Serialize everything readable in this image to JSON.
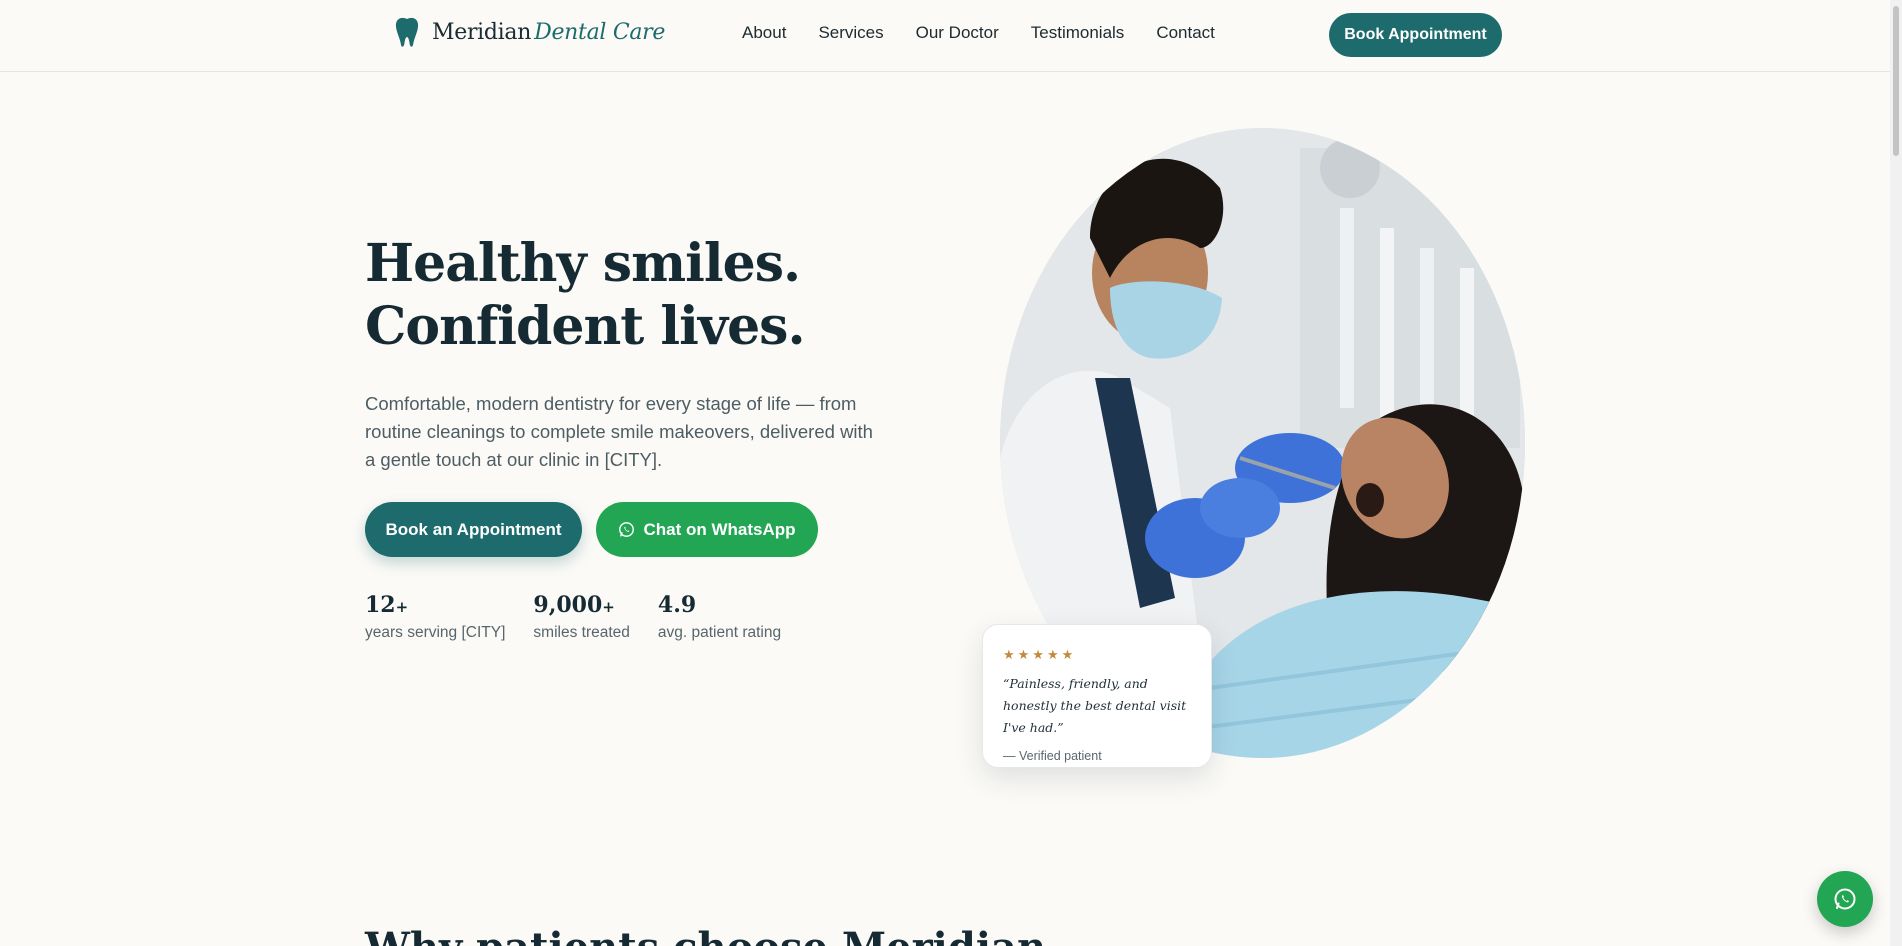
{
  "brand": {
    "name": "Meridian",
    "accent": "Dental Care",
    "icon": "tooth-icon",
    "color": "#1d6b6c"
  },
  "nav": {
    "items": [
      "About",
      "Services",
      "Our Doctor",
      "Testimonials",
      "Contact"
    ],
    "cta": "Book Appointment"
  },
  "hero": {
    "title_line1": "Healthy smiles.",
    "title_line2": "Confident lives.",
    "subtitle": "Comfortable, modern dentistry for every stage of life — from routine cleanings to complete smile makeovers, delivered with a gentle touch at our clinic in [CITY].",
    "primary_cta": "Book an Appointment",
    "whatsapp_cta": "Chat on WhatsApp",
    "whatsapp_color": "#22a654",
    "stats": [
      {
        "value": "12",
        "suffix": "+",
        "label": "years serving [CITY]"
      },
      {
        "value": "9,000",
        "suffix": "+",
        "label": "smiles treated"
      },
      {
        "value": "4.9",
        "suffix": "",
        "label": "avg. patient rating"
      }
    ]
  },
  "review": {
    "stars": "★★★★★",
    "quote": "“Painless, friendly, and honestly the best dental visit I've had.”",
    "author": "— Verified patient",
    "star_color": "#c28a3a"
  },
  "next_section": {
    "title": "Why patients choose Meridian"
  }
}
